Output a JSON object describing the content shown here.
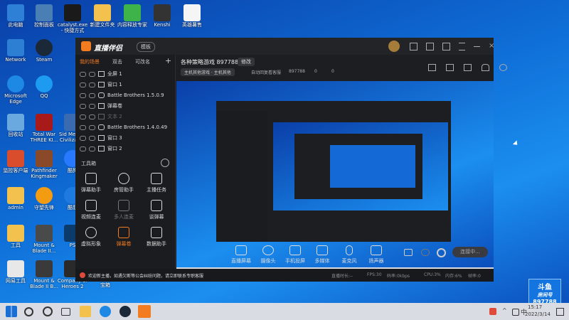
{
  "desktop": {
    "icons": [
      {
        "label": "此电脑",
        "color": "#2e7fd6"
      },
      {
        "label": "控制面板",
        "color": "#4a7fb6"
      },
      {
        "label": "catalyst.exe - 快捷方式",
        "color": "#1a1a1a"
      },
      {
        "label": "新建文件夹",
        "color": "#f2c14e"
      },
      {
        "label": "内容释放专家",
        "color": "#3db34a"
      },
      {
        "label": "Kenshi",
        "color": "#333333"
      },
      {
        "label": "英雄薯售",
        "color": "#f5f5f5"
      },
      {
        "label": "Network",
        "color": "#2d7fd4"
      },
      {
        "label": "Steam",
        "color": "#1b2838"
      },
      {
        "label": "Microsoft Edge",
        "color": "#1e88e5"
      },
      {
        "label": "QQ",
        "color": "#1d9bf0"
      },
      {
        "label": "回收站",
        "color": "#6aa8e0"
      },
      {
        "label": "Total War THREE KI...",
        "color": "#a81a1a"
      },
      {
        "label": "Sid Meier's Civilizati...",
        "color": "#3a6ab0"
      },
      {
        "label": "监控客户端",
        "color": "#d94c2c"
      },
      {
        "label": "Pathfinder Kingmaker",
        "color": "#8a4a2a"
      },
      {
        "label": "酷狗",
        "color": "#2979ff"
      },
      {
        "label": "admin",
        "color": "#f2c14e"
      },
      {
        "label": "守望先锋",
        "color": "#f39c12"
      },
      {
        "label": "酷我",
        "color": "#1f7ae0"
      },
      {
        "label": "工具",
        "color": "#f2c14e"
      },
      {
        "label": "Mount & Blade II...",
        "color": "#4a4a4a"
      },
      {
        "label": "PS",
        "color": "#0b3b6b"
      },
      {
        "label": "网易工具",
        "color": "#e8e8e8"
      },
      {
        "label": "Mount & Blade II B...",
        "color": "#3a3a3a"
      },
      {
        "label": "Company of Heroes 2",
        "color": "#2a2a2a"
      },
      {
        "label": "宝箱",
        "color": "#c33"
      }
    ]
  },
  "window": {
    "brand": "直播伴侣",
    "mode_badge": "模板",
    "stream_title": "各种策略游戏 897788",
    "edit_button": "修改",
    "category": "主机其他游戏 · 主机其他",
    "auto_reply": "自动回复看客服",
    "room_id": "897788",
    "like_count": "0",
    "viewer_count": "0",
    "left_tabs": [
      "我的场景",
      "双击",
      "可改名"
    ],
    "add_symbol": "+",
    "sources": [
      {
        "name": "全屏 1"
      },
      {
        "name": "窗口 1"
      },
      {
        "name": "Battle Brothers 1.5.0.9"
      },
      {
        "name": "弹幕卷"
      },
      {
        "name": "文本 2"
      },
      {
        "name": "Battle Brothers 1.4.0.49"
      },
      {
        "name": "窗口 3"
      },
      {
        "name": "窗口 2"
      }
    ],
    "toolbox_title": "工具箱",
    "tools": [
      "弹幕助手",
      "房管助手",
      "主播任务",
      "视频连麦",
      "多人连麦",
      "谈弹幕",
      "虚拟形象",
      "弹幕卷",
      "数据助手"
    ],
    "announce": "欢迎新主播，如遇欠断等公会纠纷问题，请立即联系专职客服",
    "controls": [
      "直播屏幕",
      "摄像头",
      "手机投屏",
      "多媒体",
      "麦克风",
      "扬声器"
    ],
    "go_live_button": "连接中...",
    "stats": [
      "直播时长:--",
      "FPS:30",
      "码率:0kbps",
      "CPU:3%",
      "内存:6%",
      "帧率:0"
    ]
  },
  "badge": {
    "line1": "斗鱼",
    "line2": "房间号",
    "room": "897788"
  },
  "taskbar": {
    "time": "15:17",
    "date": "2022/3/14",
    "tray_lang": "中"
  },
  "colors": {
    "accent": "#f47c20",
    "window_bg": "#1d1e22",
    "badge": "#1475e0"
  }
}
